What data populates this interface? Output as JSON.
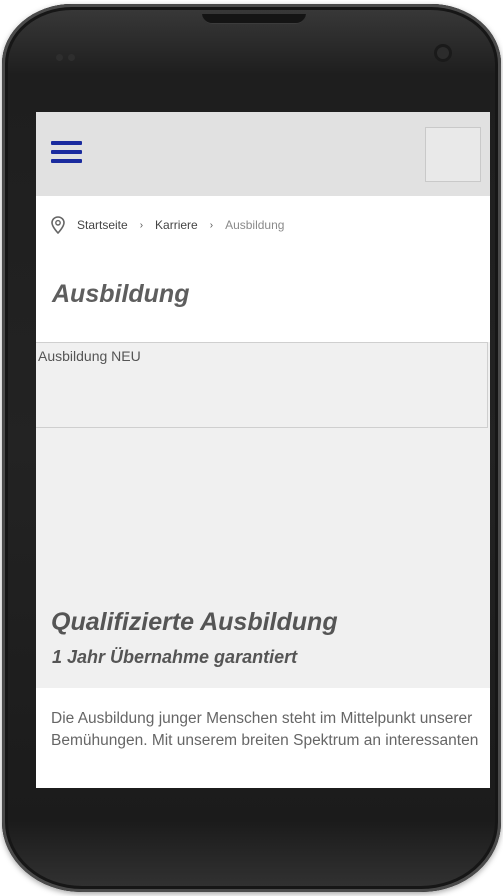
{
  "breadcrumb": {
    "items": [
      "Startseite",
      "Karriere"
    ],
    "separator": "›",
    "current": "Ausbildung"
  },
  "page": {
    "title": "Ausbildung"
  },
  "hero": {
    "image_alt_label": "Ausbildung NEU",
    "heading": "Qualifizierte Ausbildung",
    "subheading": "1 Jahr Übernahme garantiert"
  },
  "content": {
    "intro": "Die Ausbildung junger Menschen steht im Mittelpunkt unserer Bemühungen. Mit unserem breiten Spektrum an interessanten"
  },
  "icons": {
    "menu": "hamburger-menu-icon",
    "location": "map-pin-icon"
  },
  "colors": {
    "menu_icon": "#1a2b9e",
    "header_bg": "#e1e1e1",
    "hero_bg": "#f0f0f0"
  }
}
